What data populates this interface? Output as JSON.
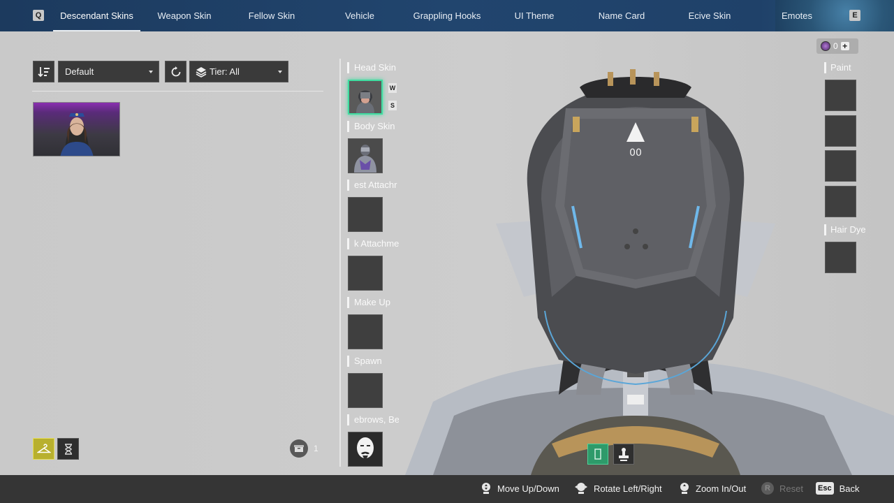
{
  "topbar": {
    "key_left": "Q",
    "key_right": "E",
    "tabs": [
      {
        "label": "Descendant Skins",
        "active": true
      },
      {
        "label": "Weapon Skin"
      },
      {
        "label": "Fellow Skin"
      },
      {
        "label": "Vehicle"
      },
      {
        "label": "Grappling Hooks"
      },
      {
        "label": "UI Theme"
      },
      {
        "label": "Name Card"
      },
      {
        "label": "Ecive Skin"
      },
      {
        "label": "Emotes"
      }
    ]
  },
  "filters": {
    "sort_icon": "sort-icon",
    "sort_value": "Default",
    "reset_icon": "refresh-icon",
    "tier_icon": "layers-icon",
    "tier_value": "Tier: All"
  },
  "inventory": {
    "count": "1",
    "box_icon": "storage-box-icon"
  },
  "slots": {
    "head_skin": "Head Skin",
    "ws_w": "W",
    "ws_s": "S",
    "body_skin": "Body Skin",
    "chest_attachment": "est Attachr",
    "back_attachment": "k Attachme",
    "make_up": "Make Up",
    "spawn": "Spawn",
    "eyebrows": "ebrows, Be"
  },
  "right_panel": {
    "currency_value": "0",
    "currency_plus": "+",
    "paint": "Paint",
    "hair_dye": "Hair Dye"
  },
  "bottombar": {
    "move": "Move Up/Down",
    "rotate": "Rotate Left/Right",
    "zoom": "Zoom In/Out",
    "reset_key": "R",
    "reset": "Reset",
    "back_key": "Esc",
    "back": "Back"
  },
  "colors": {
    "topbar": "#21456e",
    "selected_accent": "#3fdca0",
    "active_filter": "#c9c24a",
    "bottombar": "#353535"
  }
}
